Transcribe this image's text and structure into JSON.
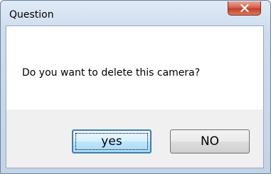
{
  "window": {
    "title": "Question",
    "close_icon": "close-icon"
  },
  "dialog": {
    "message": "Do you want to delete this camera?",
    "buttons": {
      "yes_label": "yes",
      "no_label": "NO"
    }
  },
  "colors": {
    "close_button": "#c43f27",
    "default_button_border": "#3c7fb1",
    "frame": "#c3d4e8"
  }
}
